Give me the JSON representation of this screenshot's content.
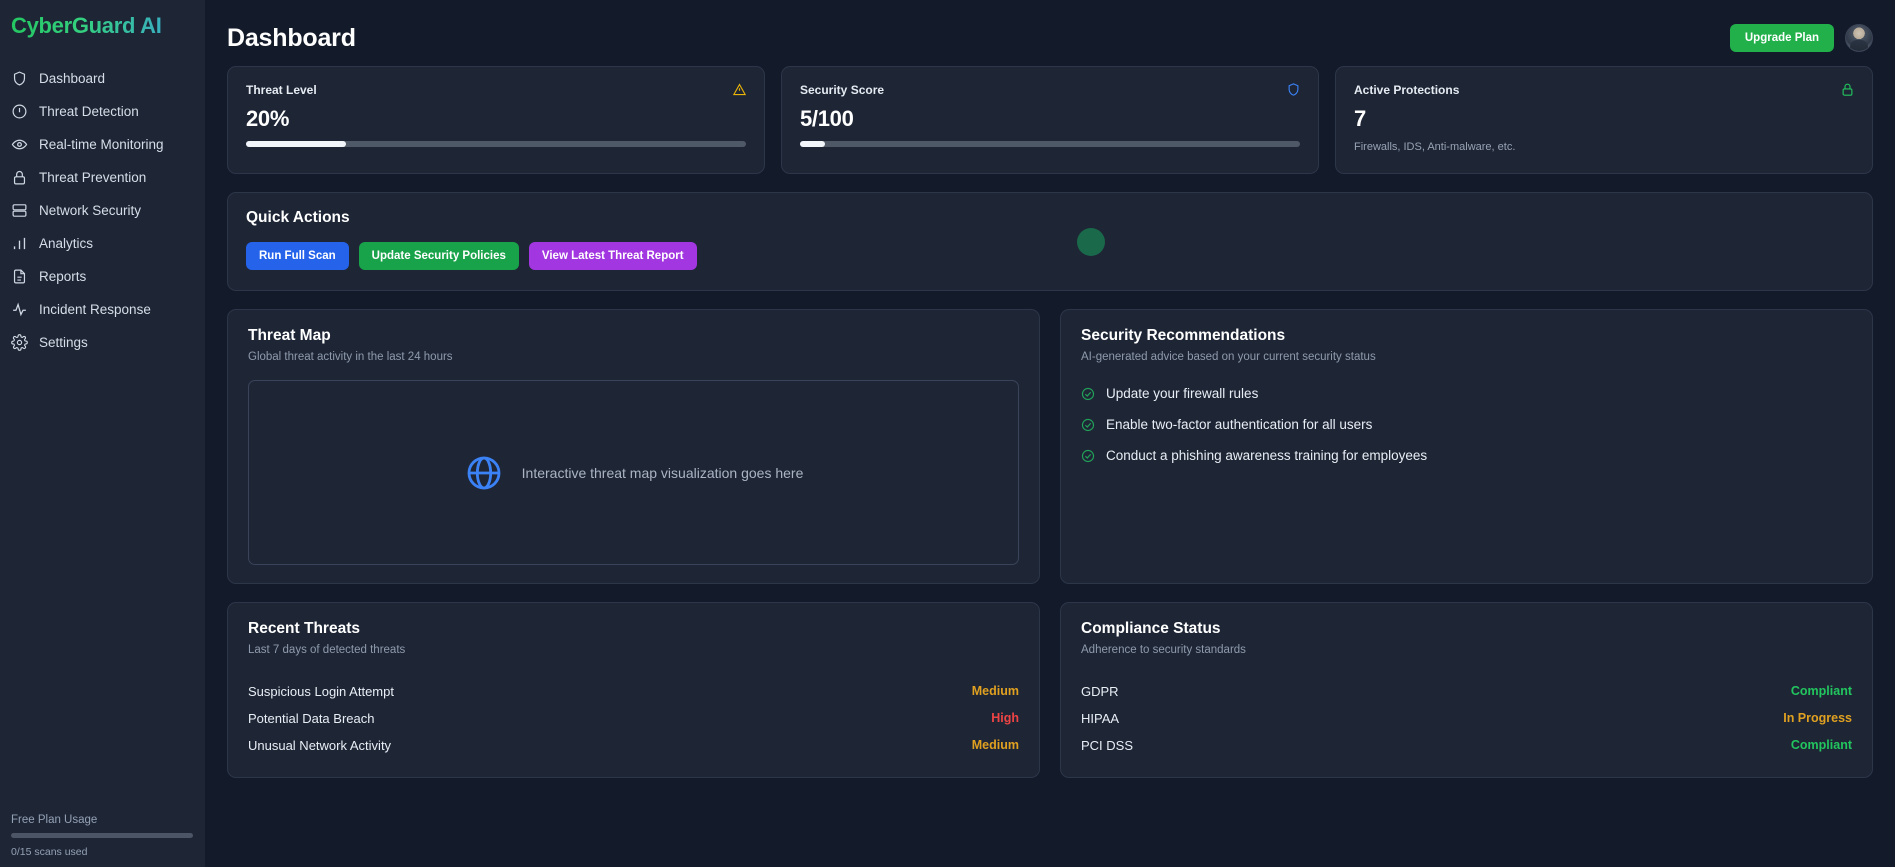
{
  "sidebar": {
    "logo": "CyberGuard AI",
    "items": [
      {
        "label": "Dashboard",
        "icon": "shield-icon"
      },
      {
        "label": "Threat Detection",
        "icon": "alert-circle-icon"
      },
      {
        "label": "Real-time Monitoring",
        "icon": "eye-icon"
      },
      {
        "label": "Threat Prevention",
        "icon": "lock-icon"
      },
      {
        "label": "Network Security",
        "icon": "server-icon"
      },
      {
        "label": "Analytics",
        "icon": "bar-chart-icon"
      },
      {
        "label": "Reports",
        "icon": "document-icon"
      },
      {
        "label": "Incident Response",
        "icon": "activity-icon"
      },
      {
        "label": "Settings",
        "icon": "gear-icon"
      }
    ],
    "plan": {
      "label": "Free Plan Usage",
      "usage_text": "0/15 scans used",
      "percent": 0
    }
  },
  "header": {
    "title": "Dashboard",
    "upgrade_label": "Upgrade Plan",
    "avatar_name": "user-avatar"
  },
  "stats": [
    {
      "label": "Threat Level",
      "value": "20%",
      "percent": 20,
      "icon": "warning-triangle-icon",
      "icon_color": "#eab308",
      "sub": ""
    },
    {
      "label": "Security Score",
      "value": "5/100",
      "percent": 5,
      "icon": "shield-icon",
      "icon_color": "#3b82f6",
      "sub": ""
    },
    {
      "label": "Active Protections",
      "value": "7",
      "percent": null,
      "icon": "lock-icon",
      "icon_color": "#22c55e",
      "sub": "Firewalls, IDS, Anti-malware, etc."
    }
  ],
  "quick_actions": {
    "title": "Quick Actions",
    "buttons": [
      {
        "label": "Run Full Scan",
        "color": "#2563eb"
      },
      {
        "label": "Update Security Policies",
        "color": "#18a34a"
      },
      {
        "label": "View Latest Threat Report",
        "color": "#a236e0"
      }
    ],
    "status_dot_color": "#19694a"
  },
  "threat_map": {
    "title": "Threat Map",
    "subtitle": "Global threat activity in the last 24 hours",
    "placeholder": "Interactive threat map visualization goes here",
    "icon": "globe-icon",
    "icon_color": "#3b82f6"
  },
  "recommendations": {
    "title": "Security Recommendations",
    "subtitle": "AI-generated advice based on your current security status",
    "items": [
      "Update your firewall rules",
      "Enable two-factor authentication for all users",
      "Conduct a phishing awareness training for employees"
    ],
    "check_color": "#22a55a"
  },
  "recent_threats": {
    "title": "Recent Threats",
    "subtitle": "Last 7 days of detected threats",
    "rows": [
      {
        "name": "Suspicious Login Attempt",
        "severity": "Medium",
        "severity_color": "#e0a020"
      },
      {
        "name": "Potential Data Breach",
        "severity": "High",
        "severity_color": "#ef4444"
      },
      {
        "name": "Unusual Network Activity",
        "severity": "Medium",
        "severity_color": "#e0a020"
      }
    ]
  },
  "compliance": {
    "title": "Compliance Status",
    "subtitle": "Adherence to security standards",
    "rows": [
      {
        "name": "GDPR",
        "status": "Compliant",
        "status_color": "#22c55e"
      },
      {
        "name": "HIPAA",
        "status": "In Progress",
        "status_color": "#e0a020"
      },
      {
        "name": "PCI DSS",
        "status": "Compliant",
        "status_color": "#22c55e"
      }
    ]
  },
  "theme": {
    "sidebar_bg": "#1e2636",
    "main_bg": "#131a29",
    "card_bg": "#1e2636",
    "card_border": "#2c3648",
    "accent_green": "#22c55e",
    "accent_blue": "#3b82f6"
  }
}
